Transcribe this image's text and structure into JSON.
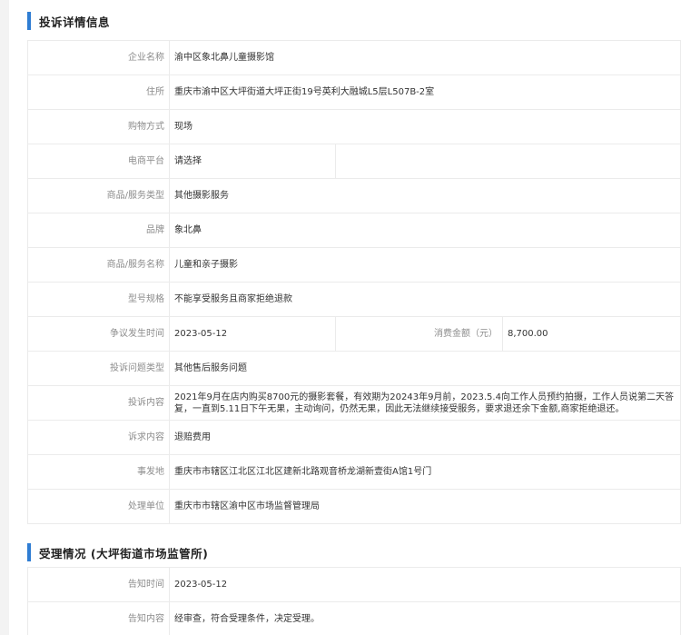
{
  "complaint_section": {
    "title": "投诉详情信息",
    "rows": {
      "company_name": {
        "label": "企业名称",
        "value": "渝中区象北鼻儿童摄影馆"
      },
      "address": {
        "label": "住所",
        "value": "重庆市渝中区大坪街道大坪正街19号英利大融城L5层L507B-2室"
      },
      "purchase_method": {
        "label": "购物方式",
        "value": "现场"
      },
      "ecommerce_platform": {
        "label": "电商平台",
        "value": "请选择"
      },
      "service_type": {
        "label": "商品/服务类型",
        "value": "其他摄影服务"
      },
      "brand": {
        "label": "品牌",
        "value": "象北鼻"
      },
      "service_name": {
        "label": "商品/服务名称",
        "value": "儿童和亲子摄影"
      },
      "model_spec": {
        "label": "型号规格",
        "value": "不能享受服务且商家拒绝退款"
      },
      "dispute_time": {
        "label": "争议发生时间",
        "value": "2023-05-12"
      },
      "amount": {
        "label": "消费金额（元）",
        "value": "8,700.00"
      },
      "problem_type": {
        "label": "投诉问题类型",
        "value": "其他售后服务问题"
      },
      "content": {
        "label": "投诉内容",
        "value": "2021年9月在店内购买8700元的摄影套餐，有效期为20243年9月前，2023.5.4向工作人员预约拍摄，工作人员说第二天答复，一直到5.11日下午无果，主动询问，仍然无果，因此无法继续接受服务，要求退还余下金额,商家拒绝退还。"
      },
      "demand": {
        "label": "诉求内容",
        "value": "退赔费用"
      },
      "location": {
        "label": "事发地",
        "value": "重庆市市辖区江北区江北区建新北路观音桥龙湖新壹街A馆1号门"
      },
      "handling_unit": {
        "label": "处理单位",
        "value": "重庆市市辖区渝中区市场监督管理局"
      }
    }
  },
  "acceptance_section": {
    "title": "受理情况 (大坪街道市场监管所)",
    "rows": {
      "notice_time": {
        "label": "告知时间",
        "value": "2023-05-12"
      },
      "notice_content": {
        "label": "告知内容",
        "value": "经审查，符合受理条件，决定受理。"
      }
    }
  },
  "colors": {
    "accent": "#2f7dd3",
    "border": "#ebebeb",
    "label_text": "#8c8c8c",
    "value_text": "#333333"
  }
}
